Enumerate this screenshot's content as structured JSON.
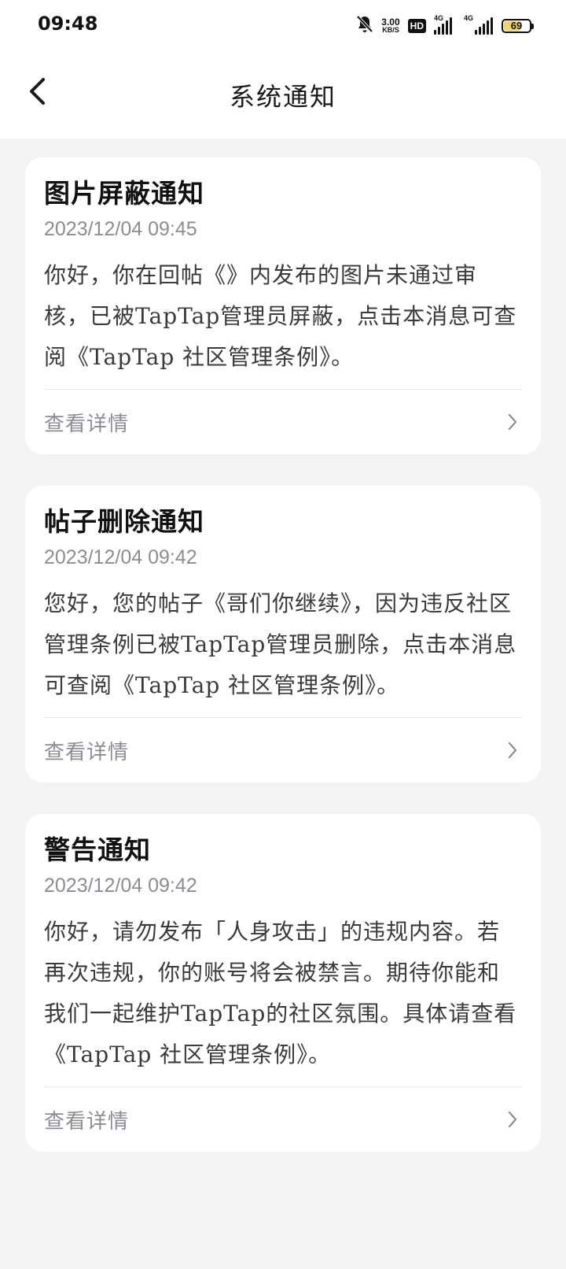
{
  "status_bar": {
    "time": "09:48",
    "net_speed_value": "3.00",
    "net_speed_unit": "KB/S",
    "hd_label": "HD",
    "signal1_label": "4G",
    "signal2_label": "4G",
    "battery_level": "69",
    "icons": [
      "bell-muted-icon",
      "signal-icon",
      "signal-icon",
      "battery-icon"
    ],
    "battery_fill_color": "#f2d36b"
  },
  "header": {
    "title": "系统通知",
    "back_icon": "chevron-left-icon"
  },
  "notifications": [
    {
      "title": "图片屏蔽通知",
      "time": "2023/12/04 09:45",
      "body": "你好，你在回帖《》内发布的图片未通过审核，已被TapTap管理员屏蔽，点击本消息可查阅《TapTap 社区管理条例》。",
      "action_label": "查看详情"
    },
    {
      "title": "帖子删除通知",
      "time": "2023/12/04 09:42",
      "body": "您好，您的帖子《哥们你继续》，因为违反社区管理条例已被TapTap管理员删除，点击本消息可查阅《TapTap 社区管理条例》。",
      "action_label": "查看详情"
    },
    {
      "title": "警告通知",
      "time": "2023/12/04 09:42",
      "body": "你好，请勿发布「人身攻击」的违规内容。若再次违规，你的账号将会被禁言。期待你能和我们一起维护TapTap的社区氛围。具体请查看《TapTap 社区管理条例》。",
      "action_label": "查看详情"
    }
  ],
  "colors": {
    "page_background": "#f2f3f5",
    "card_background": "#ffffff",
    "secondary_text": "#8a8d93"
  }
}
